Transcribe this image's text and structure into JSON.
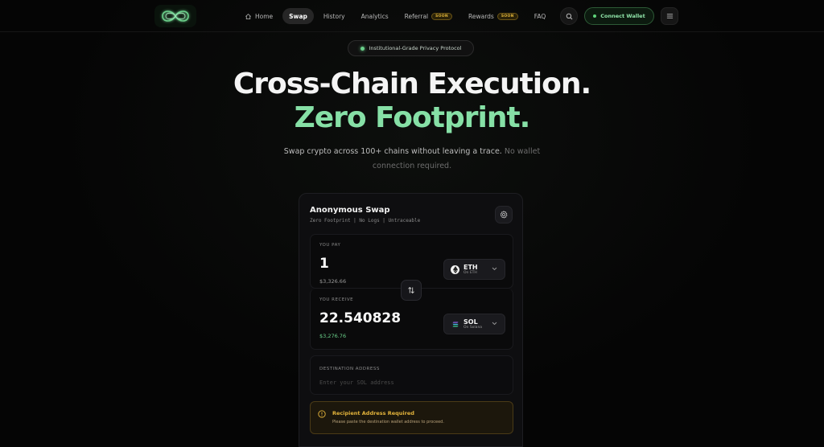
{
  "nav": {
    "links": [
      {
        "label": "Home"
      },
      {
        "label": "Swap"
      },
      {
        "label": "History"
      },
      {
        "label": "Analytics"
      },
      {
        "label": "Referral",
        "badge": "SOON"
      },
      {
        "label": "Rewards",
        "badge": "SOON"
      },
      {
        "label": "FAQ"
      }
    ],
    "connect_label": "Connect Wallet"
  },
  "hero": {
    "pill": "Institutional-Grade Privacy Protocol",
    "title_line1": "Cross-Chain Execution.",
    "title_line2": "Zero Footprint.",
    "subtitle": "Swap crypto across 100+ chains without leaving a trace.",
    "subtitle_muted": "No wallet connection required."
  },
  "swap": {
    "title": "Anonymous Swap",
    "subtitle": "Zero Footprint | No Logs | Untraceable",
    "pay": {
      "label": "YOU PAY",
      "amount": "1",
      "usd": "$3,326.66",
      "token": "ETH",
      "chain": "On ETH"
    },
    "receive": {
      "label": "YOU RECEIVE",
      "amount": "22.540828",
      "usd": "$3,276.76",
      "token": "SOL",
      "chain": "On Solana"
    },
    "destination": {
      "label": "DESTINATION ADDRESS",
      "value": "",
      "placeholder": "Enter your SOL address"
    },
    "warning": {
      "title": "Recipient Address Required",
      "text": "Please paste the destination wallet address to proceed."
    }
  },
  "colors": {
    "accent": "#86e0a6",
    "warning": "#e4b43b",
    "background": "#050505",
    "card": "#0e0e10"
  }
}
